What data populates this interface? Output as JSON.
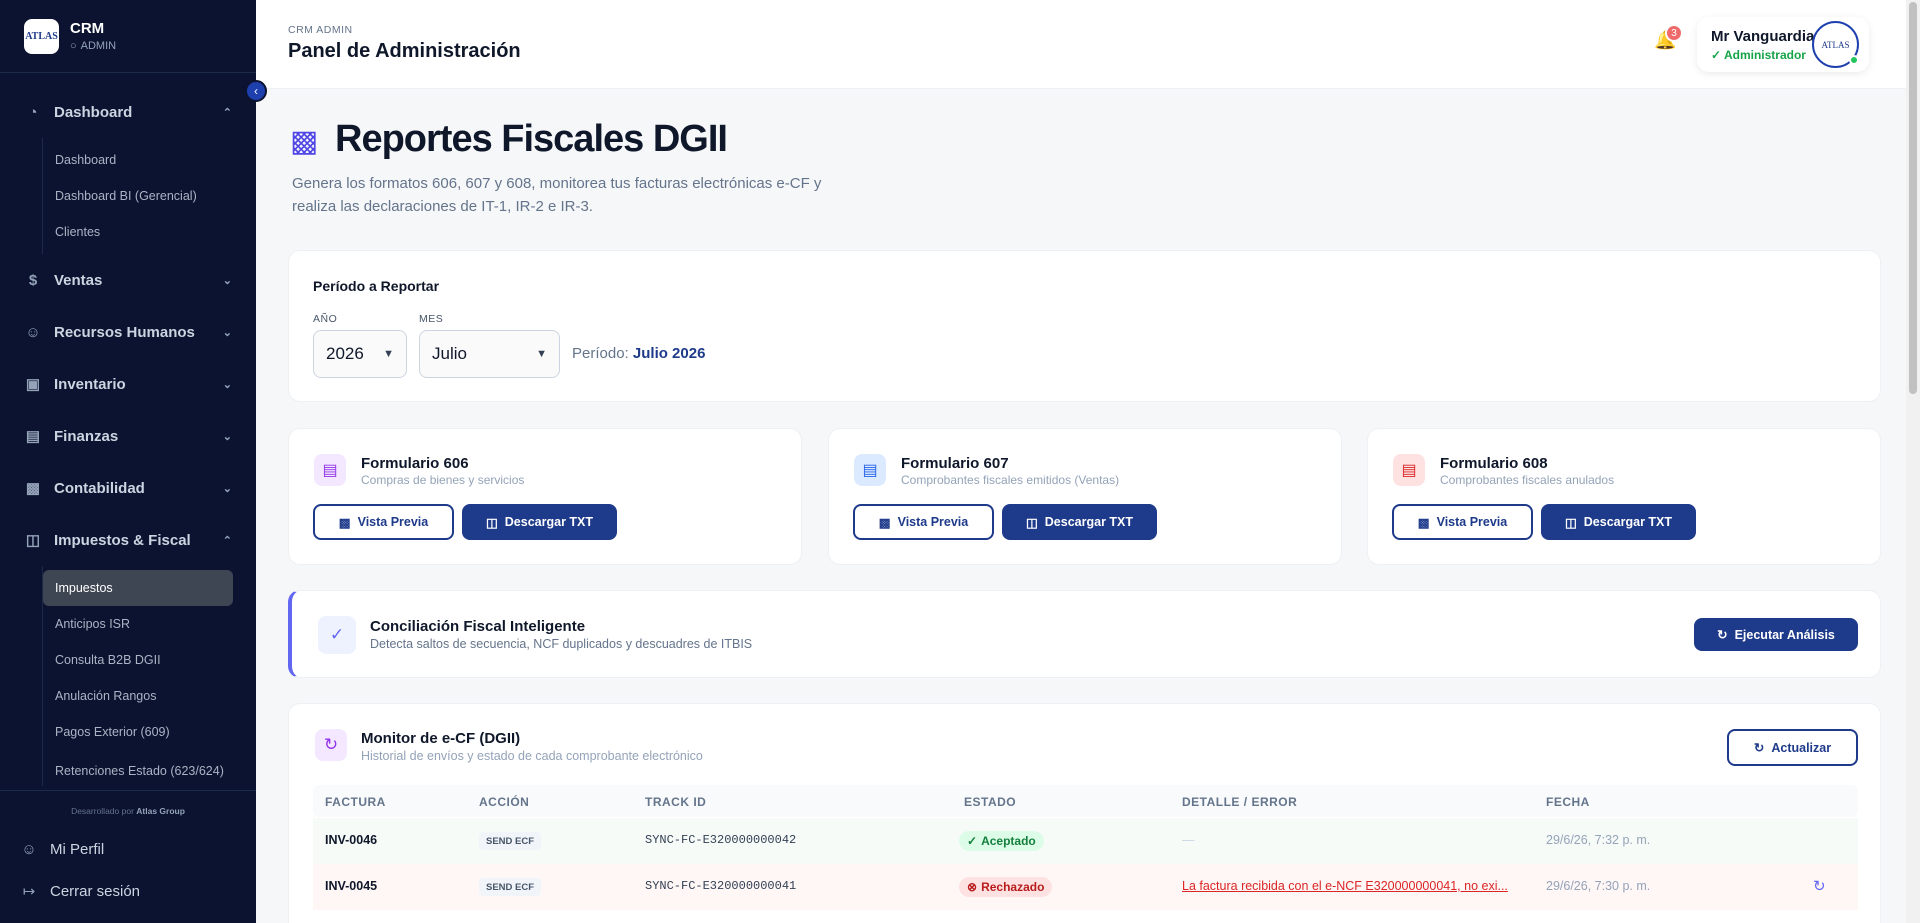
{
  "brand": {
    "logo_text": "ATLAS",
    "name": "CRM",
    "role": "ADMIN"
  },
  "sidebar": {
    "collapse_icon": "chevron-left-icon",
    "groups": [
      {
        "label": "Dashboard",
        "icon": "gauge-icon",
        "expanded": true,
        "items": [
          "Dashboard",
          "Dashboard BI (Gerencial)",
          "Clientes"
        ]
      },
      {
        "label": "Ventas",
        "icon": "dollar-icon",
        "expanded": false
      },
      {
        "label": "Recursos Humanos",
        "icon": "users-icon",
        "expanded": false
      },
      {
        "label": "Inventario",
        "icon": "box-icon",
        "expanded": false
      },
      {
        "label": "Finanzas",
        "icon": "wallet-icon",
        "expanded": false
      },
      {
        "label": "Contabilidad",
        "icon": "chart-icon",
        "expanded": false
      },
      {
        "label": "Impuestos & Fiscal",
        "icon": "file-icon",
        "expanded": true,
        "items": [
          "Impuestos",
          "Anticipos ISR",
          "Consulta B2B DGII",
          "Anulación Rangos",
          "Pagos Exterior (609)",
          "Retenciones Estado (623/624)"
        ],
        "active": "Impuestos"
      }
    ],
    "footer": {
      "developed_prefix": "Desarrollado por",
      "developed_by": "Atlas Group",
      "profile": "Mi Perfil",
      "logout": "Cerrar sesión"
    }
  },
  "header": {
    "breadcrumb": "CRM ADMIN",
    "title": "Panel de Administración",
    "notifications": "3",
    "user_name": "Mr Vanguardia",
    "user_role": "Administrador",
    "avatar_text": "ATLAS"
  },
  "page": {
    "title": "Reportes Fiscales DGII",
    "subtitle": "Genera los formatos 606, 607 y 608, monitorea tus facturas electrónicas e-CF y realiza las declaraciones de IT-1, IR-2 e IR-3."
  },
  "period": {
    "title": "Período a Reportar",
    "year_label": "AÑO",
    "year_value": "2026",
    "month_label": "MES",
    "month_value": "Julio",
    "info_label": "Período:",
    "info_value": "Julio 2026"
  },
  "forms": [
    {
      "title": "Formulario 606",
      "subtitle": "Compras de bienes y servicios",
      "icon_color": "#9333ea",
      "icon_bg": "#f3e8ff",
      "preview": "Vista Previa",
      "download": "Descargar TXT"
    },
    {
      "title": "Formulario 607",
      "subtitle": "Comprobantes fiscales emitidos (Ventas)",
      "icon_color": "#2563eb",
      "icon_bg": "#dbeafe",
      "preview": "Vista Previa",
      "download": "Descargar TXT"
    },
    {
      "title": "Formulario 608",
      "subtitle": "Comprobantes fiscales anulados",
      "icon_color": "#dc2626",
      "icon_bg": "#fee2e2",
      "preview": "Vista Previa",
      "download": "Descargar TXT"
    }
  ],
  "conciliation": {
    "title": "Conciliación Fiscal Inteligente",
    "subtitle": "Detecta saltos de secuencia, NCF duplicados y descuadres de ITBIS",
    "button": "Ejecutar Análisis"
  },
  "monitor": {
    "title": "Monitor de e-CF (DGII)",
    "subtitle": "Historial de envíos y estado de cada comprobante electrónico",
    "refresh": "Actualizar",
    "columns": [
      "FACTURA",
      "ACCIÓN",
      "TRACK ID",
      "ESTADO",
      "DETALLE / ERROR",
      "FECHA"
    ],
    "rows": [
      {
        "invoice": "INV-0046",
        "action": "SEND ECF",
        "track": "SYNC-FC-E320000000042",
        "status": "Aceptado",
        "detail": "—",
        "date": "29/6/26, 7:32 p. m."
      },
      {
        "invoice": "INV-0045",
        "action": "SEND ECF",
        "track": "SYNC-FC-E320000000041",
        "status": "Rechazado",
        "detail": "La factura recibida con el e-NCF E320000000041, no exi...",
        "date": "29/6/26, 7:30 p. m."
      }
    ]
  },
  "colors": {
    "sidebar_bg": "#0b1330",
    "primary": "#1e3a8a",
    "accent": "#6366f1",
    "success": "#16a34a",
    "danger": "#dc2626"
  }
}
